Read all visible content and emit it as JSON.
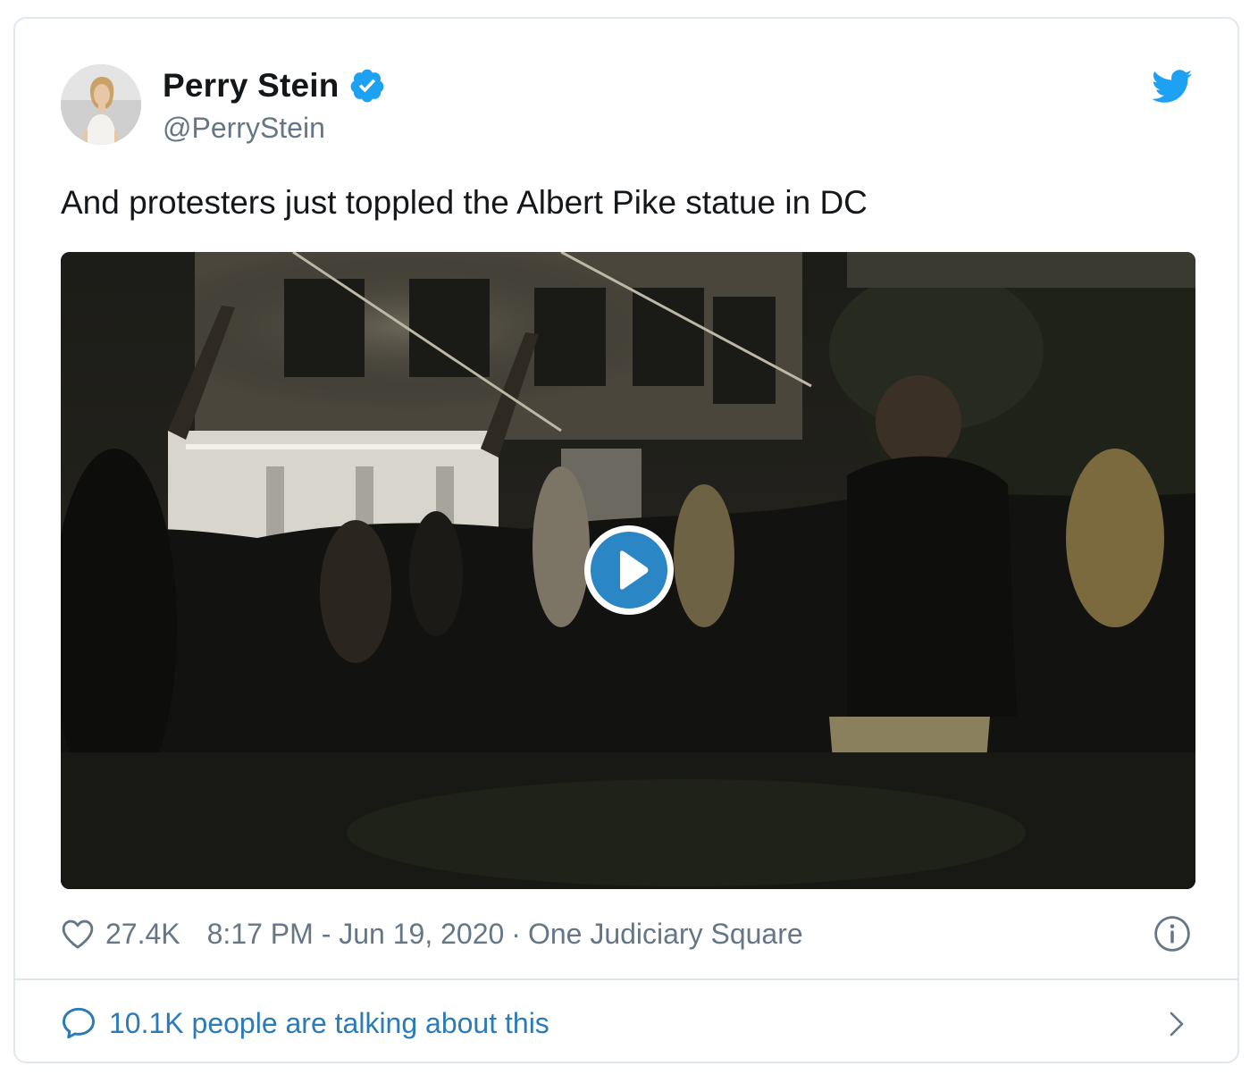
{
  "author": {
    "display_name": "Perry Stein",
    "handle": "@PerryStein",
    "verified": true
  },
  "tweet": {
    "text": "And protesters just toppled the Albert Pike statue in DC"
  },
  "media": {
    "type": "video",
    "play_icon": "play-icon"
  },
  "meta": {
    "likes": "27.4K",
    "timestamp": "8:17 PM - Jun 19, 2020",
    "separator": "·",
    "location": "One Judiciary Square"
  },
  "conversation": {
    "label": "10.1K people are talking about this"
  },
  "icons": {
    "brand": "twitter-bird-icon",
    "verified": "verified-badge-icon",
    "like": "heart-icon",
    "info": "info-icon",
    "reply": "speech-bubble-icon",
    "more": "chevron-right-icon"
  },
  "colors": {
    "brand_blue": "#1da1f2",
    "link_blue": "#2b7bb9",
    "text_primary": "#14171a",
    "text_secondary": "#657786",
    "border": "#e1e8ed",
    "play_button": "#2b86c5"
  }
}
